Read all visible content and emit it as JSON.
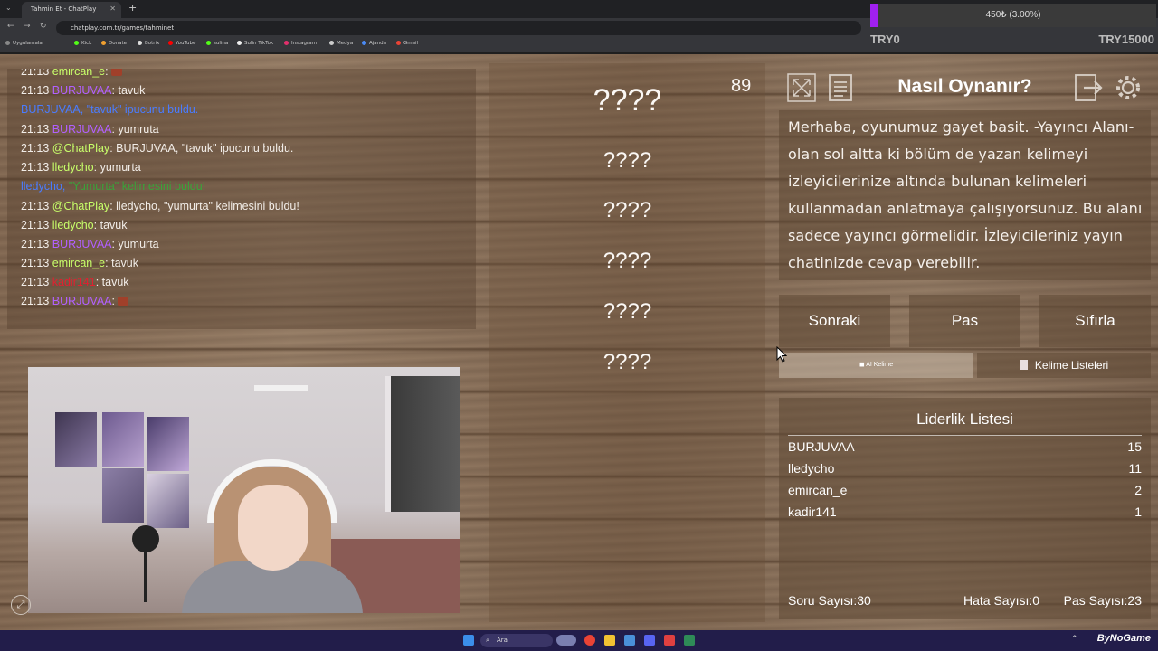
{
  "browser": {
    "tab_title": "Tahmin Et - ChatPlay",
    "url": "chatplay.com.tr/games/tahminet",
    "bookmarks": [
      "Uygulamalar",
      "Kick",
      "Donate",
      "Botrix",
      "YouTube",
      "sulina",
      "Sulin TikTok",
      "Instagram",
      "Medya",
      "Ajanda",
      "Gmail"
    ]
  },
  "donation": {
    "label": "450₺ (3.00%)",
    "progress": 0.03,
    "min_label": "TRY0",
    "max_label": "TRY15000"
  },
  "chat": {
    "lines": [
      {
        "time": "21:13",
        "user": "emircan_e",
        "msg": ""
      },
      {
        "time": "21:13",
        "user": "BURJUVAA",
        "msg": "tavuk"
      },
      {
        "time": "",
        "user": "BURJUVAA, ",
        "msg": "\"tavuk\" ipucunu buldu."
      },
      {
        "time": "21:13",
        "user": "BURJUVAA",
        "msg": "yumruta"
      },
      {
        "time": "21:13",
        "user": "@ChatPlay",
        "msg": "BURJUVAA, \"tavuk\" ipucunu buldu."
      },
      {
        "time": "21:13",
        "user": "lledycho",
        "msg": "yumurta"
      },
      {
        "time": "",
        "user": "lledycho, ",
        "msg": "\"Yumurta\" kelimesini buldu!"
      },
      {
        "time": "21:13",
        "user": "@ChatPlay",
        "msg": "lledycho, \"yumurta\" kelimesini buldu!"
      },
      {
        "time": "21:13",
        "user": "lledycho",
        "msg": "tavuk"
      },
      {
        "time": "21:13",
        "user": "BURJUVAA",
        "msg": "yumurta"
      },
      {
        "time": "21:13",
        "user": "emircan_e",
        "msg": "tavuk"
      },
      {
        "time": "21:13",
        "user": "kadir141",
        "msg": "tavuk"
      },
      {
        "time": "21:13",
        "user": "BURJUVAA",
        "msg": ""
      }
    ]
  },
  "game": {
    "timer": "89",
    "words": [
      "????",
      "????",
      "????",
      "????",
      "????",
      "????"
    ]
  },
  "panel": {
    "title": "Nasıl Oynanır?",
    "description": "Merhaba, oyunumuz gayet basit. -Yayıncı Alanı- olan sol altta ki bölüm de yazan kelimeyi izleyicilerinize altında bulunan kelimeleri kullanmadan anlatmaya çalışıyorsunuz. Bu alanı sadece yayıncı görmelidir. İzleyicileriniz yayın chatinizde cevap verebilir.",
    "buttons": {
      "next": "Sonraki",
      "pass": "Pas",
      "reset": "Sıfırla",
      "ai_word": "AI Kelime",
      "word_lists": "Kelime Listeleri"
    }
  },
  "leaderboard": {
    "title": "Liderlik Listesi",
    "rows": [
      {
        "name": "BURJUVAA",
        "score": "15"
      },
      {
        "name": "lledycho",
        "score": "11"
      },
      {
        "name": "emircan_e",
        "score": "2"
      },
      {
        "name": "kadir141",
        "score": "1"
      }
    ],
    "question_count": "Soru Sayısı:30",
    "error_count": "Hata Sayısı:0",
    "pass_count": "Pas Sayısı:23"
  },
  "taskbar": {
    "search": "Ara",
    "watermark": "ByNoGame"
  },
  "colors": {
    "username_purple": "#b260ff",
    "username_green": "#c8ff6a",
    "system_blue": "#4a7cff",
    "donation_fill": "#a020f0"
  }
}
